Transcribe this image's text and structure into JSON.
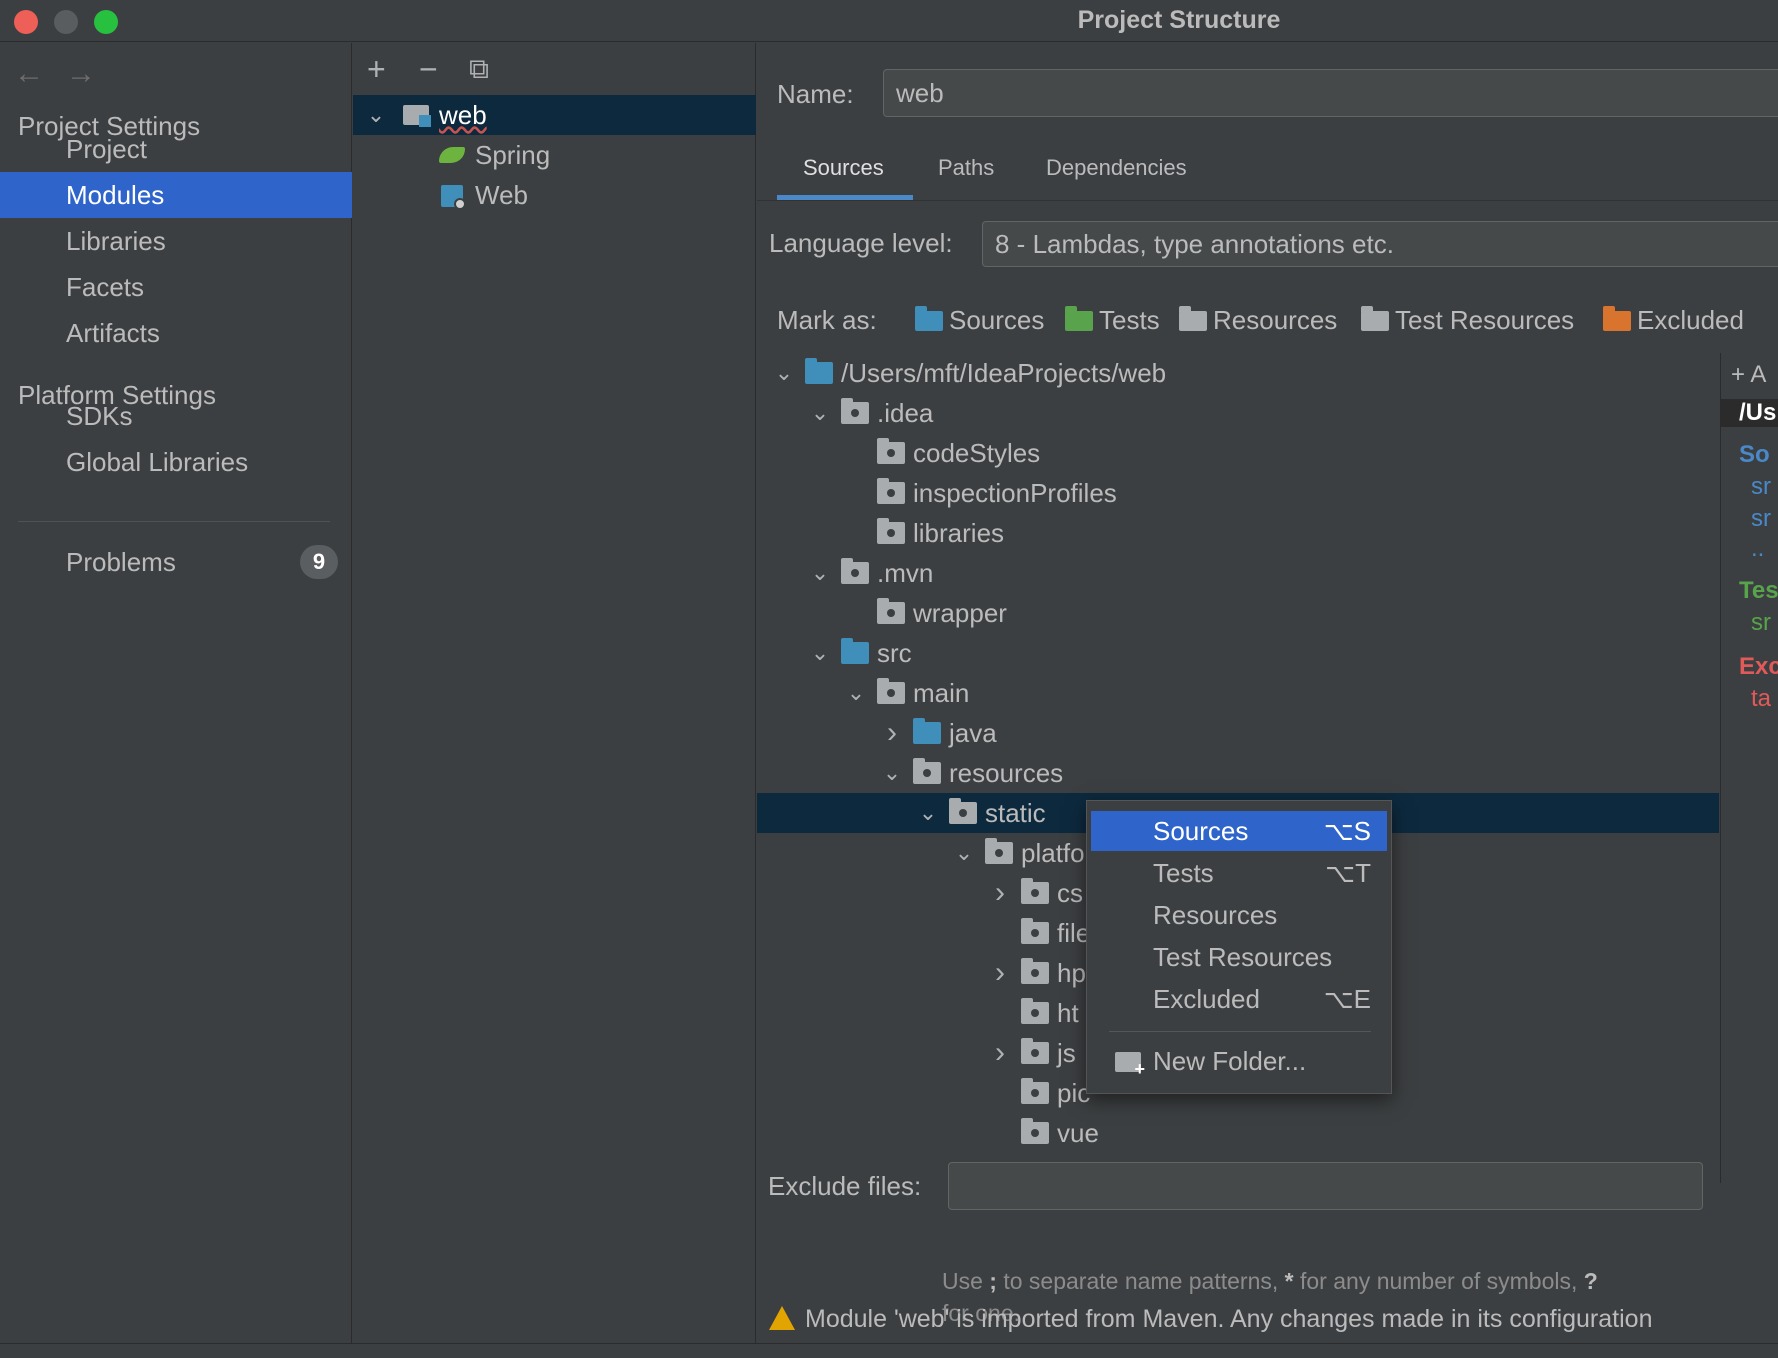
{
  "window": {
    "title": "Project Structure"
  },
  "nav": {
    "back": "←",
    "forward": "→"
  },
  "sidebar": {
    "project_settings": "Project Settings",
    "project_items": [
      "Project",
      "Modules",
      "Libraries",
      "Facets",
      "Artifacts"
    ],
    "platform_settings": "Platform Settings",
    "platform_items": [
      "SDKs",
      "Global Libraries"
    ],
    "problems": {
      "label": "Problems",
      "count": "9"
    }
  },
  "modules_toolbar": {
    "add": "+",
    "remove": "−",
    "copy": "⧉"
  },
  "modules": [
    {
      "name": "web",
      "expanded": true
    },
    {
      "name": "Spring"
    },
    {
      "name": "Web"
    }
  ],
  "main": {
    "name_label": "Name:",
    "name_value": "web",
    "tabs": [
      "Sources",
      "Paths",
      "Dependencies"
    ],
    "active_tab": "Sources",
    "language_label": "Language level:",
    "language_value": "8 - Lambdas, type annotations etc.",
    "mark_as_label": "Mark as:",
    "mark_as": [
      {
        "label": "Sources",
        "color": "#3f8fba"
      },
      {
        "label": "Tests",
        "color": "#59a34c"
      },
      {
        "label": "Resources",
        "color": "#a9acaf"
      },
      {
        "label": "Test Resources",
        "color": "#a9acaf"
      },
      {
        "label": "Excluded",
        "color": "#d9742e"
      }
    ],
    "tree": [
      {
        "name": "/Users/mft/IdeaProjects/web",
        "depth": 0,
        "chevron": "open",
        "kind": "src"
      },
      {
        "name": ".idea",
        "depth": 1,
        "chevron": "open",
        "kind": "plain"
      },
      {
        "name": "codeStyles",
        "depth": 2,
        "chevron": "none",
        "kind": "plain"
      },
      {
        "name": "inspectionProfiles",
        "depth": 2,
        "chevron": "none",
        "kind": "plain"
      },
      {
        "name": "libraries",
        "depth": 2,
        "chevron": "none",
        "kind": "plain"
      },
      {
        "name": ".mvn",
        "depth": 1,
        "chevron": "open",
        "kind": "plain"
      },
      {
        "name": "wrapper",
        "depth": 2,
        "chevron": "none",
        "kind": "plain"
      },
      {
        "name": "src",
        "depth": 1,
        "chevron": "open",
        "kind": "src"
      },
      {
        "name": "main",
        "depth": 2,
        "chevron": "open",
        "kind": "plain"
      },
      {
        "name": "java",
        "depth": 3,
        "chevron": "closed",
        "kind": "src"
      },
      {
        "name": "resources",
        "depth": 3,
        "chevron": "open",
        "kind": "plain"
      },
      {
        "name": "static",
        "depth": 4,
        "chevron": "open",
        "kind": "plain",
        "selected": true
      },
      {
        "name": "platfo",
        "depth": 5,
        "chevron": "open",
        "kind": "plain"
      },
      {
        "name": "cs",
        "depth": 6,
        "chevron": "closed",
        "kind": "plain"
      },
      {
        "name": "file",
        "depth": 6,
        "chevron": "none",
        "kind": "plain"
      },
      {
        "name": "hp",
        "depth": 6,
        "chevron": "closed",
        "kind": "plain"
      },
      {
        "name": "ht",
        "depth": 6,
        "chevron": "none",
        "kind": "plain"
      },
      {
        "name": "js",
        "depth": 6,
        "chevron": "closed",
        "kind": "plain"
      },
      {
        "name": "pic",
        "depth": 6,
        "chevron": "none",
        "kind": "plain"
      },
      {
        "name": "vue",
        "depth": 6,
        "chevron": "none",
        "kind": "plain"
      }
    ],
    "exclude_label": "Exclude files:",
    "exclude_value": "",
    "hint_parts": [
      "Use ",
      ";",
      " to separate name patterns, ",
      "*",
      " for any number of symbols, ",
      "?",
      " for one."
    ],
    "warning": "Module 'web' is imported from Maven. Any changes made in its configuration"
  },
  "right_panel": [
    {
      "text": "+ A",
      "color": "#bbbbbb"
    },
    {
      "text": "/Us",
      "color": "#ffffff"
    },
    {
      "text": "So",
      "color": "#4a88c7"
    },
    {
      "text": "sr",
      "color": "#4a88c7"
    },
    {
      "text": "sr",
      "color": "#4a88c7"
    },
    {
      "text": "..",
      "color": "#4a88c7"
    },
    {
      "text": "Tes",
      "color": "#59a34c"
    },
    {
      "text": "sr",
      "color": "#59a34c"
    },
    {
      "text": "Exc",
      "color": "#e05a5a"
    },
    {
      "text": "ta",
      "color": "#e05a5a"
    }
  ],
  "context_menu": {
    "items": [
      {
        "label": "Sources",
        "shortcut": "⌥S",
        "selected": true
      },
      {
        "label": "Tests",
        "shortcut": "⌥T"
      },
      {
        "label": "Resources",
        "shortcut": ""
      },
      {
        "label": "Test Resources",
        "shortcut": ""
      },
      {
        "label": "Excluded",
        "shortcut": "⌥E"
      }
    ],
    "new_folder": "New Folder..."
  }
}
